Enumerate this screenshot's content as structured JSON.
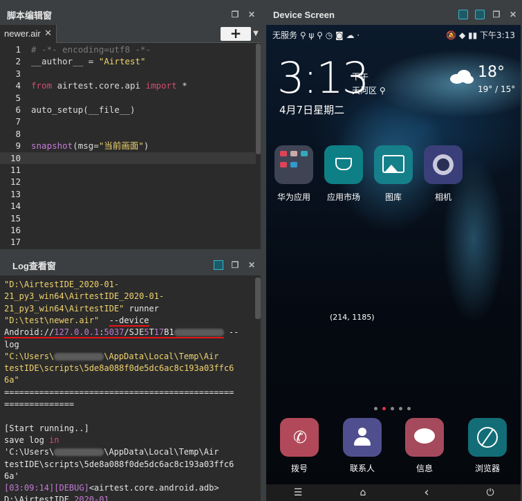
{
  "editor": {
    "title": "脚本编辑窗",
    "tab_label": "newer.air",
    "tab_close": "✕",
    "add_label": "+",
    "add_arrow": "▼",
    "line_numbers": [
      "1",
      "2",
      "3",
      "4",
      "5",
      "6",
      "7",
      "8",
      "9",
      "10",
      "11",
      "12",
      "13",
      "14",
      "15",
      "16",
      "17"
    ],
    "lines": {
      "l1": "# -*- encoding=utf8 -*-",
      "l2_a": "__author__ = ",
      "l2_b": "\"Airtest\"",
      "l4_a": "from",
      "l4_b": " airtest.core.api ",
      "l4_c": "import",
      "l4_d": " *",
      "l6": "auto_setup(__file__)",
      "l9_a": "snapshot",
      "l9_b": "(msg=",
      "l9_c": "\"当前画面\"",
      "l9_d": ")"
    }
  },
  "log": {
    "title": "Log查看窗",
    "l1": "\"D:\\AirtestIDE_2020-01-",
    "l2": "21_py3_win64\\AirtestIDE_2020-01-",
    "l3_a": "21_py3_win64\\AirtestIDE\"",
    "l3_b": " runner",
    "l4_a": "\"D:\\test\\newer.air\"",
    "l4_b": "  ",
    "l4_c": "--device",
    "l5_a": "Android://",
    "l5_b": "127.0.0.1",
    "l5_c": ":",
    "l5_d": "5037",
    "l5_e": "/SJE",
    "l5_f": "5",
    "l5_g": "T",
    "l5_h": "17",
    "l5_i": "B1",
    "l5_j": " --",
    "l6": "log",
    "l7_a": "\"C:\\Users\\",
    "l7_b": "\\AppData\\Local\\Temp\\Air",
    "l8": "testIDE\\scripts\\5de8a088f0de5dc6ac8c193a03ffc6",
    "l9": "6a\"",
    "l10": "==============================================",
    "l11": "==============",
    "l13": "[Start running..]",
    "l14_a": "save log ",
    "l14_b": "in",
    "l15_a": "'C:\\Users\\",
    "l15_b": "\\AppData\\Local\\Temp\\Air",
    "l16": "testIDE\\scripts\\5de8a088f0de5dc6ac8c193a03ffc6",
    "l17": "6a'",
    "l18_a": "[03:09:14]",
    "l18_b": "[DEBUG]",
    "l18_c": "<airtest.core.android.adb>",
    "l19_a": "D:\\AirtestIDE_",
    "l19_b": "2020-01"
  },
  "device": {
    "title": "Device Screen",
    "status_left": "无服务 ⚲ ψ ⚲ ◷ ◙ ☁ ·",
    "status_right": "🔕 ◆ ▮▮ 下午3:13",
    "clock": "3:13",
    "ampm": "下午",
    "location": "天河区 ⚲",
    "date": "4月7日星期二",
    "temp": "18°",
    "temp_range": "19° / 15°",
    "apps": [
      {
        "label": "华为应用"
      },
      {
        "label": "应用市场"
      },
      {
        "label": "图库"
      },
      {
        "label": "相机"
      }
    ],
    "coordinate": "(214, 1185)",
    "dock": [
      {
        "label": "拨号"
      },
      {
        "label": "联系人"
      },
      {
        "label": "信息"
      },
      {
        "label": "浏览器"
      }
    ],
    "nav": {
      "menu": "☰",
      "home": "⌂",
      "back": "‹",
      "power": "⏻"
    }
  },
  "icons": {
    "float": "❐",
    "close": "✕"
  },
  "colors": {
    "keyword": "#d94b72",
    "string": "#f0d36d",
    "function": "#c47bd6",
    "comment": "#7a7a7a",
    "underline": "#ee1111"
  }
}
